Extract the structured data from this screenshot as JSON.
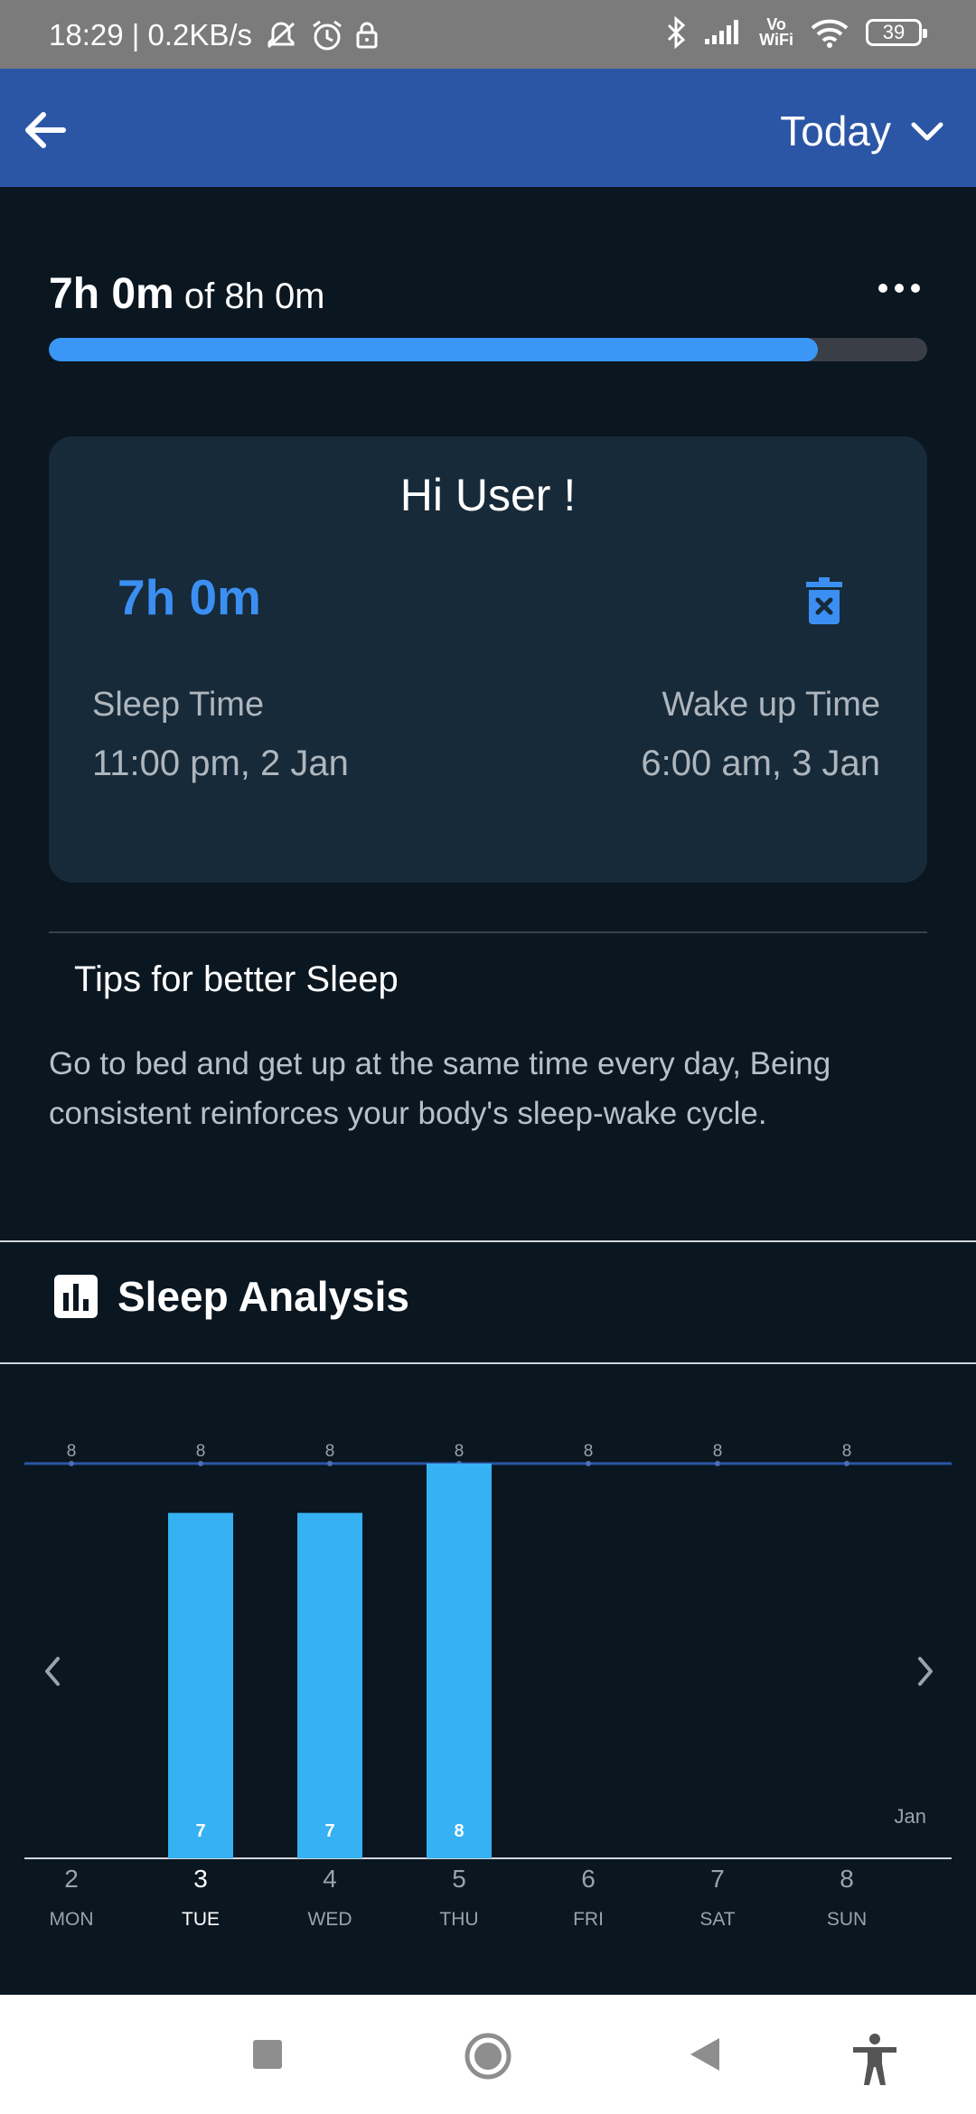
{
  "status_bar": {
    "time_speed": "18:29 | 0.2KB/s",
    "vowifi_top": "Vo",
    "vowifi_bottom": "WiFi",
    "battery": "39"
  },
  "app_bar": {
    "period_label": "Today"
  },
  "goal": {
    "achieved": "7h 0m",
    "of_label": "of 8h 0m",
    "progress_fraction": 0.875
  },
  "card": {
    "greeting": "Hi User !",
    "duration": "7h 0m",
    "sleep_label": "Sleep Time",
    "sleep_value": "11:00 pm, 2 Jan",
    "wake_label": "Wake up Time",
    "wake_value": "6:00 am, 3 Jan"
  },
  "tips": {
    "title": "Tips for better Sleep",
    "text": "Go to bed and get up at the same time every day, Being consistent reinforces your body's sleep-wake cycle."
  },
  "analysis": {
    "title": "Sleep Analysis"
  },
  "colors": {
    "app_bar": "#2b56a6",
    "accent": "#3a97f6",
    "bar": "#36b1f2",
    "goal_line": "#2b56a6",
    "background": "#0a1620",
    "card": "#172a39"
  },
  "chart_data": {
    "type": "bar",
    "categories": [
      "2",
      "3",
      "4",
      "5",
      "6",
      "7",
      "8"
    ],
    "day_labels": [
      "MON",
      "TUE",
      "WED",
      "THU",
      "FRI",
      "SAT",
      "SUN"
    ],
    "selected_index": 1,
    "values": [
      0,
      7,
      7,
      8,
      0,
      0,
      0
    ],
    "goal": 8,
    "goal_labels": [
      "8",
      "8",
      "8",
      "8",
      "8",
      "8",
      "8"
    ],
    "month_label": "Jan",
    "ylim": [
      0,
      8.5
    ]
  }
}
